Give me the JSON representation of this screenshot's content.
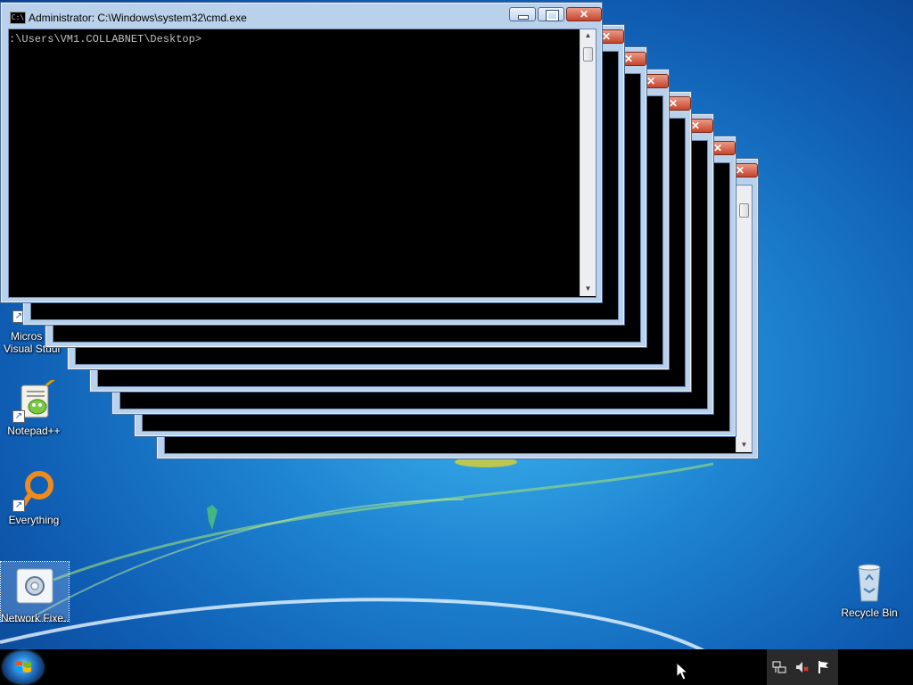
{
  "desktop": {
    "icons": [
      {
        "label": "Micros\nVisual Stud",
        "line1": "Micros",
        "line2": "Visual Studi"
      },
      {
        "label": "Notepad++"
      },
      {
        "label": "Everything"
      },
      {
        "label": "Network Fixe..."
      },
      {
        "label": "Recycle Bin"
      }
    ]
  },
  "cmd_window": {
    "title": "Administrator: C:\\Windows\\system32\\cmd.exe",
    "title_icon_text": "C:\\",
    "prompt": ":\\Users\\VM1.COLLABNET\\Desktop>"
  },
  "stacked_window_count": 7,
  "taskbar": {
    "tray_icons": [
      "network-icon",
      "volume-muted-icon",
      "action-center-flag-icon"
    ]
  },
  "colors": {
    "frame": "#b9d1ea",
    "close_button": "#c6452c",
    "console_bg": "#000000",
    "console_text": "#c0c0c0"
  }
}
